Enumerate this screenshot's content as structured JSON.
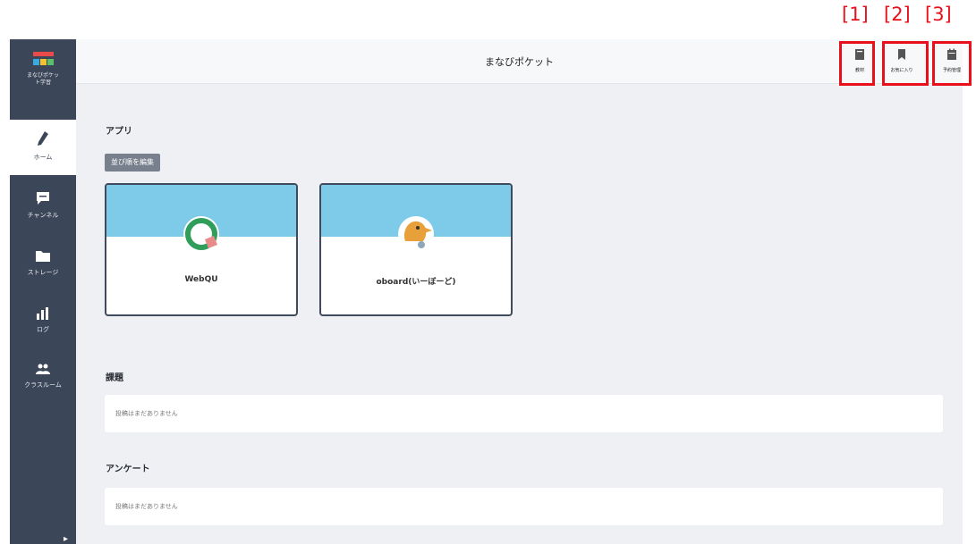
{
  "sidebar": {
    "brand_line1": "まなびポケッ",
    "brand_line2": "ト学習",
    "items": [
      {
        "label": "ホーム",
        "icon": "pencil-icon"
      },
      {
        "label": "チャンネル",
        "icon": "chat-icon"
      },
      {
        "label": "ストレージ",
        "icon": "folder-icon"
      },
      {
        "label": "ログ",
        "icon": "bar-chart-icon"
      },
      {
        "label": "クラスルーム",
        "icon": "people-icon"
      }
    ]
  },
  "header": {
    "title": "まなびポケット",
    "buttons": [
      {
        "label": "教材",
        "icon": "book-icon"
      },
      {
        "label": "お気に入り",
        "icon": "bookmark-icon"
      },
      {
        "label": "予約管理",
        "icon": "calendar-icon"
      }
    ]
  },
  "annotations": [
    "[1]",
    "[2]",
    "[3]"
  ],
  "apps": {
    "heading": "アプリ",
    "edit_label": "並び順を編集",
    "cards": [
      {
        "label": "WebQU",
        "icon": "webqu-logo-icon"
      },
      {
        "label": "oboard(いーぼーど)",
        "icon": "eboard-mascot-icon"
      }
    ]
  },
  "assignments": {
    "heading": "課題",
    "empty": "投稿はまだありません"
  },
  "survey": {
    "heading": "アンケート",
    "empty": "投稿はまだありません"
  },
  "colors": {
    "sidebar": "#3b4658",
    "card_top": "#7ecae9",
    "annotation": "#e8101a"
  }
}
